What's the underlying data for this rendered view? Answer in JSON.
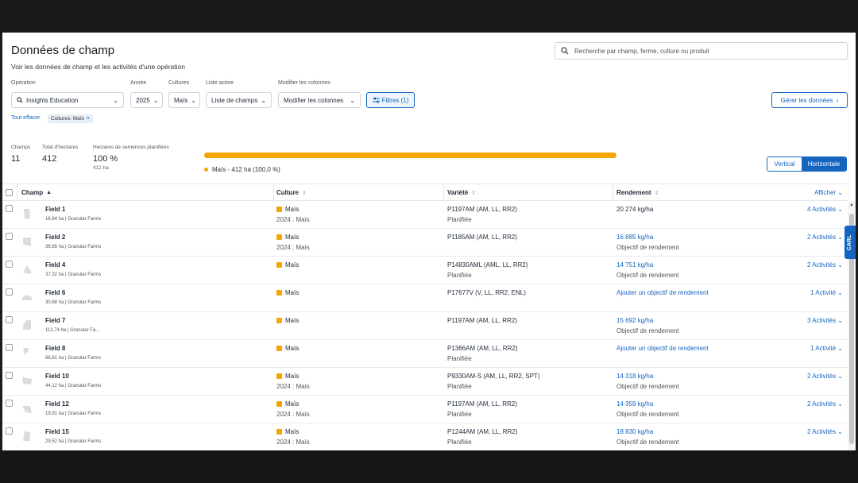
{
  "page": {
    "title": "Données de champ",
    "subtitle": "Voir les données de champ et les activités d'une opération"
  },
  "search": {
    "placeholder": "Recherche par champ, ferme, culture ou produit"
  },
  "filters": {
    "operation": {
      "label": "Opération",
      "value": "Insights Education"
    },
    "year": {
      "label": "Année",
      "value": "2025"
    },
    "crops": {
      "label": "Cultures",
      "value": "Maïs"
    },
    "active_list": {
      "label": "Liste active",
      "value": "Liste de champs"
    },
    "columns": {
      "label": "Modifier les colonnes",
      "value": "Modifier les colonnes"
    },
    "filters_button": "Filtres (1)",
    "manage_button": "Gérer les données",
    "clear_all": "Tout effacer",
    "active_chip": "Cultures: Maïs"
  },
  "summary": {
    "fields_label": "Champs",
    "fields_value": "11",
    "hectares_label": "Total d'hectares",
    "hectares_value": "412",
    "planted_label": "Hectares de semences planifiées",
    "planted_value": "100 %",
    "planted_sub": "412 ha",
    "crop_bar_percent": 100,
    "crop_legend": "Maïs - 412 ha (100,0 %)",
    "crop_color": "#f5a500"
  },
  "view_toggle": {
    "vertical": "Vertical",
    "horizontal": "Horizontale",
    "selected": "Horizontale"
  },
  "table": {
    "headers": {
      "field": "Champ",
      "crop": "Culture",
      "variety": "Variété",
      "yield": "Rendement",
      "show": "Afficher"
    },
    "rows": [
      {
        "name": "Field 1",
        "sub": "18,64 ha | Granular Farms",
        "crop": "Maïs",
        "crop_sub": "2024 : Maïs",
        "variety": "P1197AM (AM, LL, RR2)",
        "variety_sub": "Planifiée",
        "yield": "20 274 kg/ha",
        "yield_sub": "",
        "activities": "4 Activités"
      },
      {
        "name": "Field 2",
        "sub": "36,65 ha | Granular Farms",
        "crop": "Maïs",
        "crop_sub": "2024 : Maïs",
        "variety": "P1185AM (AM, LL, RR2)",
        "variety_sub": "",
        "yield": "16 885 kg/ha",
        "yield_sub": "Objectif de rendement",
        "activities": "2 Activités"
      },
      {
        "name": "Field 4",
        "sub": "37,32 ha | Granular Farms",
        "crop": "Maïs",
        "crop_sub": "",
        "variety": "P14830AML (AML, LL, RR2)",
        "variety_sub": "Planifiée",
        "yield": "14 751 kg/ha",
        "yield_sub": "Objectif de rendement",
        "activities": "2 Activités"
      },
      {
        "name": "Field 6",
        "sub": "30,88 ha | Granular Farms",
        "crop": "Maïs",
        "crop_sub": "",
        "variety": "P17677V (V, LL, RR2, ENL)",
        "variety_sub": "",
        "yield": "Ajouter un objectif de rendement",
        "yield_sub": "",
        "activities": "1 Activité"
      },
      {
        "name": "Field 7",
        "sub": "112,74 ha | Granular Fa...",
        "crop": "Maïs",
        "crop_sub": "",
        "variety": "P1197AM (AM, LL, RR2)",
        "variety_sub": "",
        "yield": "15 692 kg/ha",
        "yield_sub": "Objectif de rendement",
        "activities": "3 Activités"
      },
      {
        "name": "Field 8",
        "sub": "66,61 ha | Granular Farms",
        "crop": "Maïs",
        "crop_sub": "",
        "variety": "P1366AM (AM, LL, RR2)",
        "variety_sub": "Planifiée",
        "yield": "Ajouter un objectif de rendement",
        "yield_sub": "",
        "activities": "1 Activité"
      },
      {
        "name": "Field 10",
        "sub": "44,12 ha | Granular Farms",
        "crop": "Maïs",
        "crop_sub": "2024 : Maïs",
        "variety": "P9330AM-S (AM, LL, RR2, SPT)",
        "variety_sub": "Planifiée",
        "yield": "14 318 kg/ha",
        "yield_sub": "Objectif de rendement",
        "activities": "2 Activités"
      },
      {
        "name": "Field 12",
        "sub": "19,91 ha | Granular Farms",
        "crop": "Maïs",
        "crop_sub": "2024 : Maïs",
        "variety": "P1197AM (AM, LL, RR2)",
        "variety_sub": "Planifiée",
        "yield": "14 359 kg/ha",
        "yield_sub": "Objectif de rendement",
        "activities": "2 Activités"
      },
      {
        "name": "Field 15",
        "sub": "29,52 ha | Granular Farms",
        "crop": "Maïs",
        "crop_sub": "2024 : Maïs",
        "variety": "P1244AM (AM, LL, RR2)",
        "variety_sub": "Planifiée",
        "yield": "18 830 kg/ha",
        "yield_sub": "Objectif de rendement",
        "activities": "2 Activités"
      }
    ]
  },
  "assistant_tab": "CARL"
}
